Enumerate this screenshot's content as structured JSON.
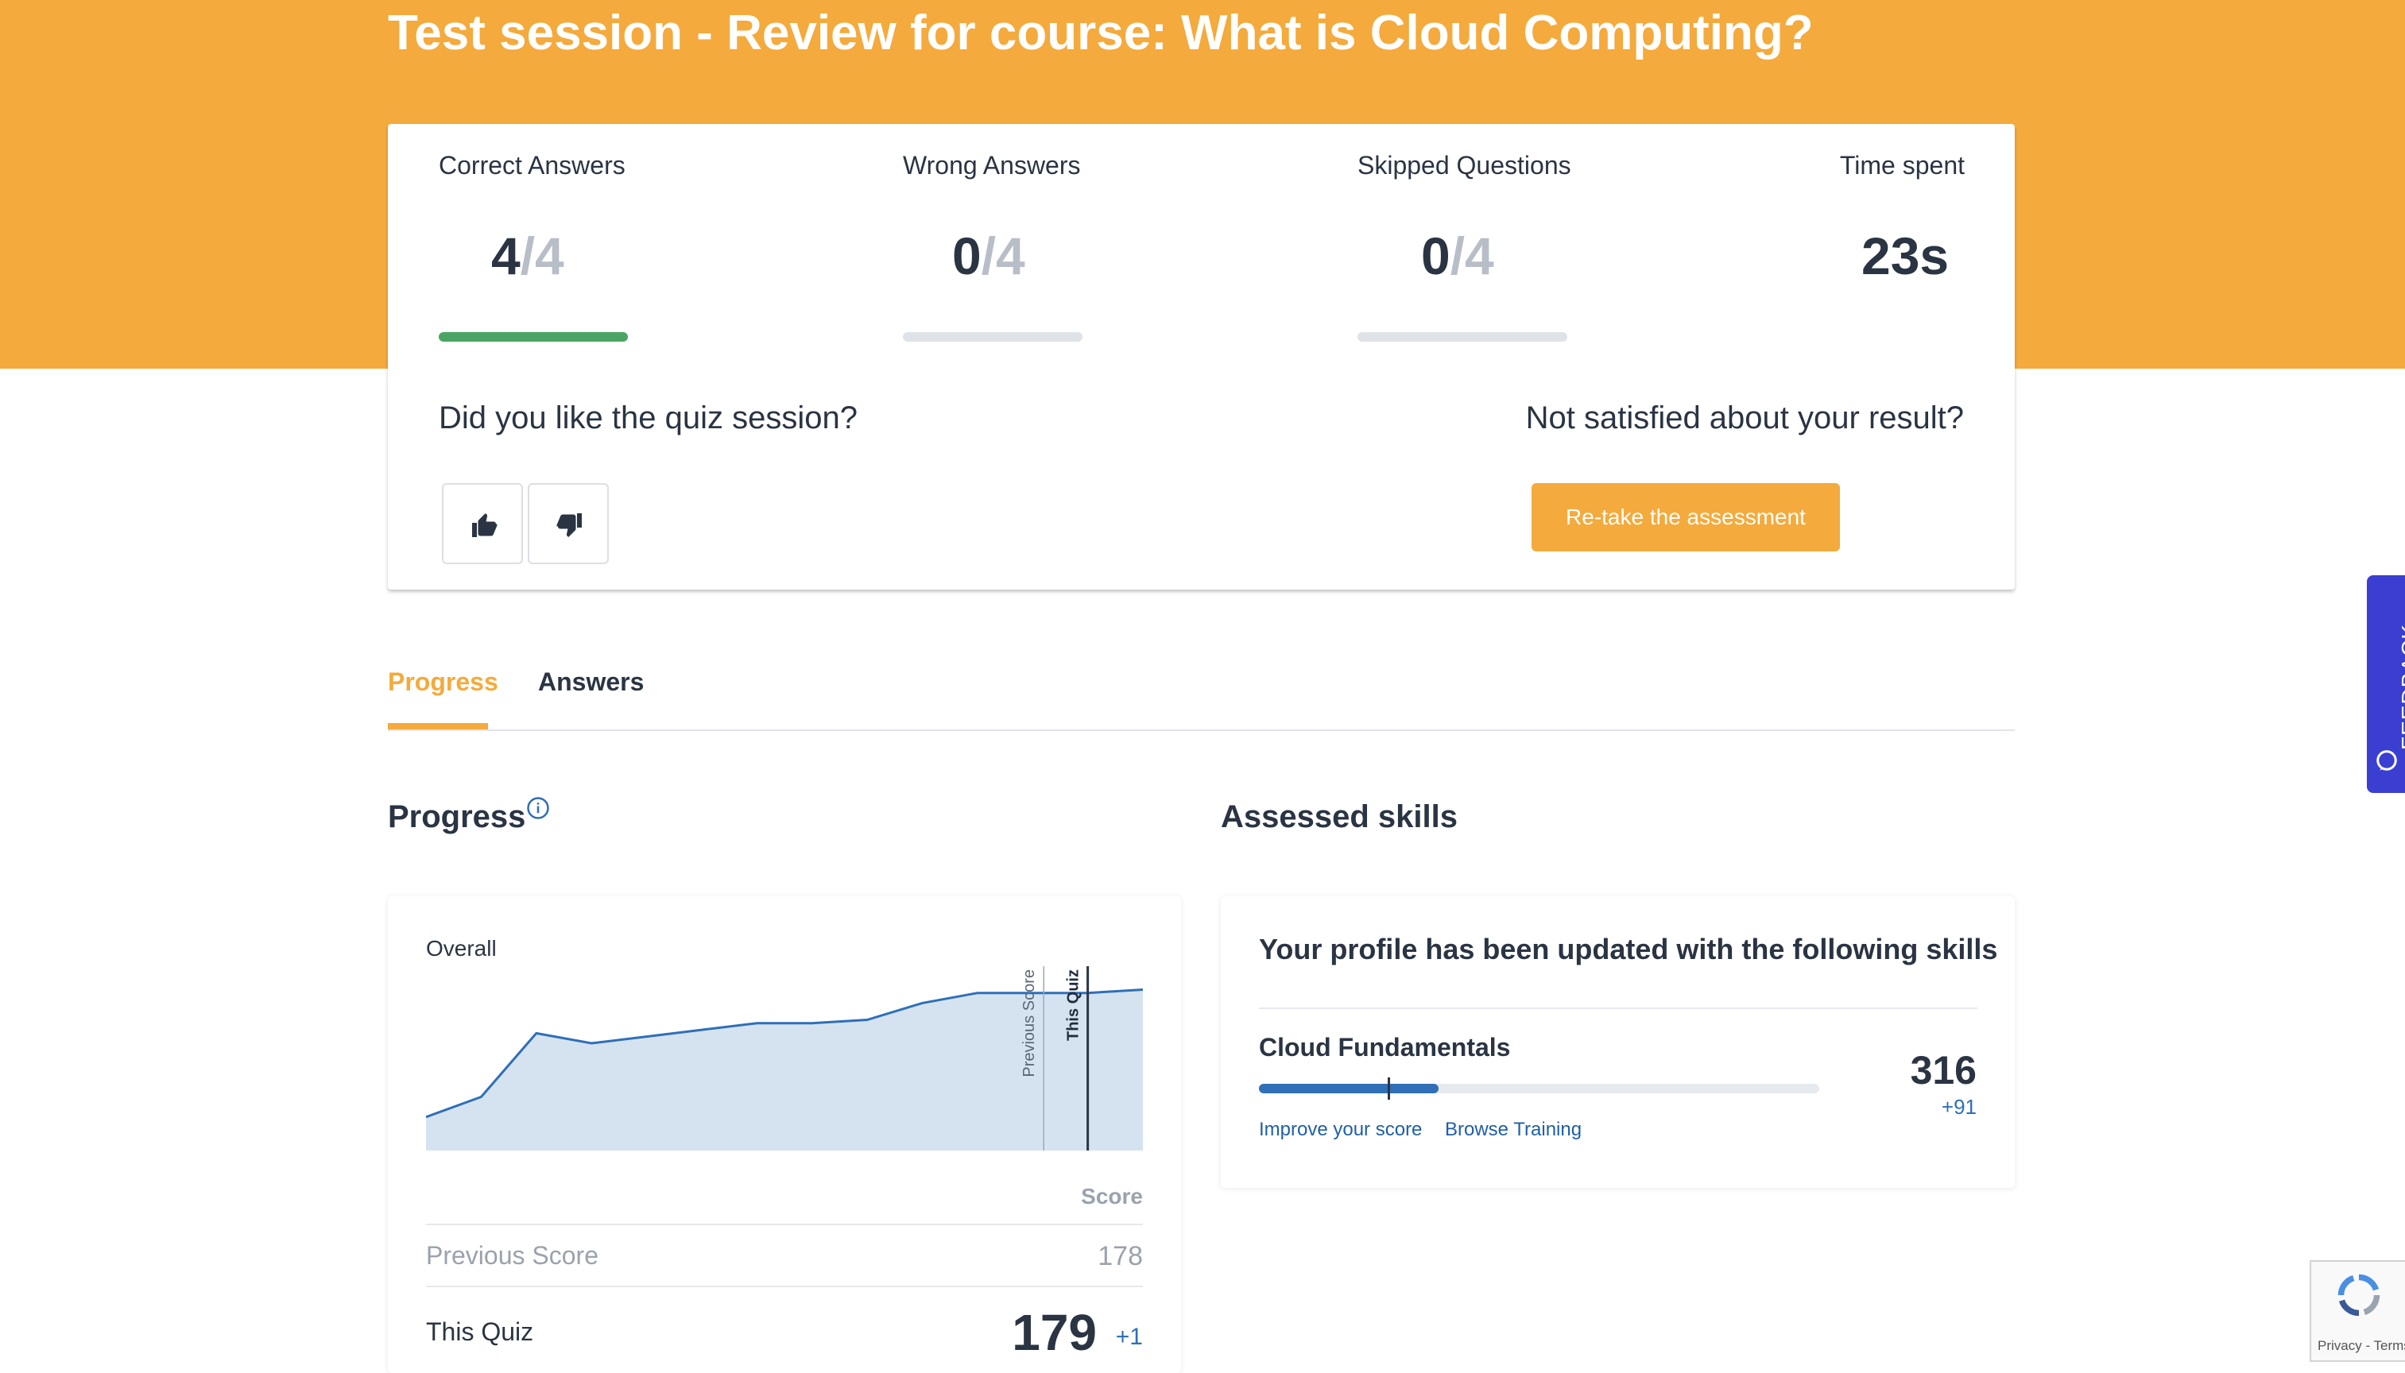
{
  "title": "Test session - Review for course: What is Cloud Computing?",
  "stats": {
    "correct": {
      "label": "Correct Answers",
      "value": "4",
      "total": "/4",
      "progress": 1.0
    },
    "wrong": {
      "label": "Wrong Answers",
      "value": "0",
      "total": "/4",
      "progress": 0
    },
    "skipped": {
      "label": "Skipped Questions",
      "value": "0",
      "total": "/4",
      "progress": 0
    },
    "time": {
      "label": "Time spent",
      "value": "23s"
    }
  },
  "feedback_question": "Did you like the quiz session?",
  "unsatisfied_question": "Not satisfied about your result?",
  "retake_label": "Re-take the assessment",
  "tabs": [
    {
      "label": "Progress",
      "active": true
    },
    {
      "label": "Answers",
      "active": false
    }
  ],
  "progress_section": {
    "title": "Progress",
    "chart_label": "Overall",
    "score_header": "Score",
    "previous_label": "Previous Score",
    "previous_score": "178",
    "this_label": "This Quiz",
    "this_score": "179",
    "this_delta": "+1"
  },
  "chart_data": {
    "type": "area",
    "title": "Overall",
    "values": [
      120,
      126,
      145,
      142,
      144,
      146,
      148,
      148,
      149,
      154,
      157,
      157,
      157,
      158
    ],
    "ylim": [
      110,
      165
    ],
    "markers": [
      {
        "label": "Previous Score",
        "index": 11
      },
      {
        "label": "This Quiz",
        "index": 12
      }
    ],
    "colors": {
      "line": "#2f6fb8",
      "fill": "#d5e3f1",
      "marker": "#2a3443"
    }
  },
  "skills_section": {
    "title": "Assessed skills",
    "card_heading": "Your profile has been updated with the following skills",
    "skills": [
      {
        "name": "Cloud Fundamentals",
        "score": "316",
        "delta": "+91",
        "level": 0.32,
        "previous_level": 0.23,
        "improve_label": "Improve your score",
        "browse_label": "Browse Training"
      }
    ]
  },
  "feedback_tab_label": "FEEDBACK",
  "recaptcha_text": "Privacy - Terms",
  "colors": {
    "accent": "#f4aa3c",
    "success": "#4aa564",
    "link": "#2f6fb8",
    "feedback": "#3a3fd1"
  }
}
